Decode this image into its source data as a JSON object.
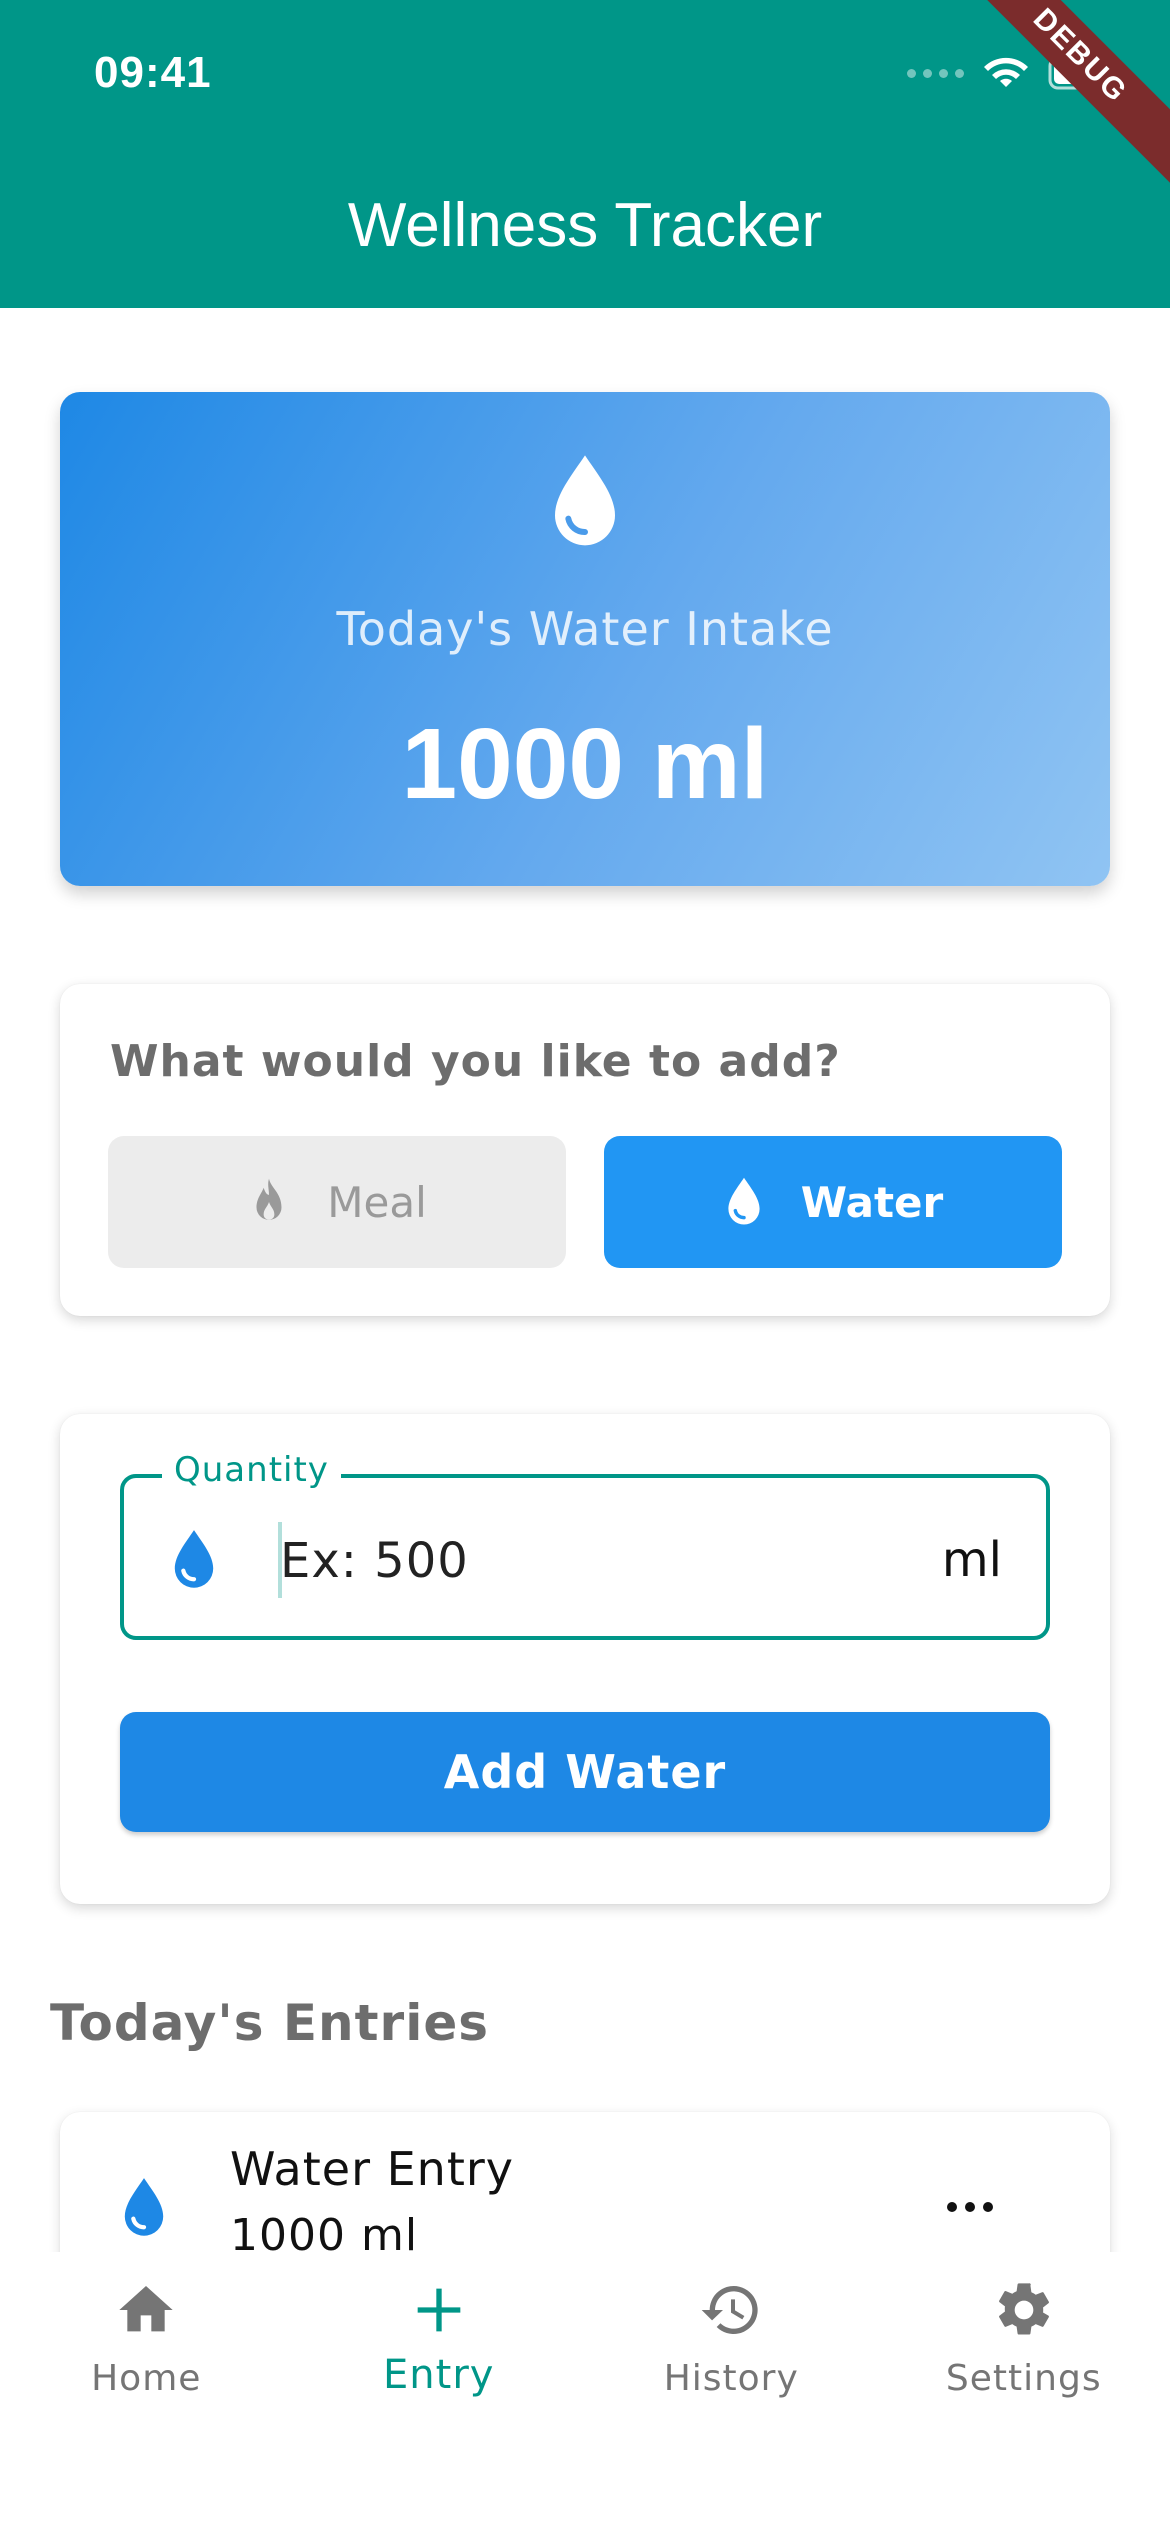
{
  "status_bar": {
    "time": "09:41"
  },
  "debug_banner": "DEBUG",
  "app_bar": {
    "title": "Wellness Tracker"
  },
  "summary": {
    "label": "Today's Water Intake",
    "value": "1000 ml"
  },
  "type_selector": {
    "title": "What would you like to add?",
    "options": [
      {
        "label": "Meal",
        "icon": "flame-icon",
        "selected": false
      },
      {
        "label": "Water",
        "icon": "water-drop-icon",
        "selected": true
      }
    ]
  },
  "quantity": {
    "label": "Quantity",
    "placeholder": "Ex: 500",
    "value": "",
    "suffix": "ml"
  },
  "add_button": {
    "label": "Add Water"
  },
  "entries": {
    "title": "Today's Entries",
    "items": [
      {
        "title": "Water Entry",
        "amount": "1000 ml",
        "icon": "water-drop-icon"
      }
    ]
  },
  "nav": {
    "items": [
      {
        "label": "Home",
        "icon": "home-icon",
        "active": false
      },
      {
        "label": "Entry",
        "icon": "plus-icon",
        "active": true
      },
      {
        "label": "History",
        "icon": "history-icon",
        "active": false
      },
      {
        "label": "Settings",
        "icon": "gear-icon",
        "active": false
      }
    ]
  },
  "colors": {
    "primary": "#009688",
    "accent_blue": "#2196f3",
    "button_blue": "#1e88e5",
    "inactive": "#757575"
  }
}
